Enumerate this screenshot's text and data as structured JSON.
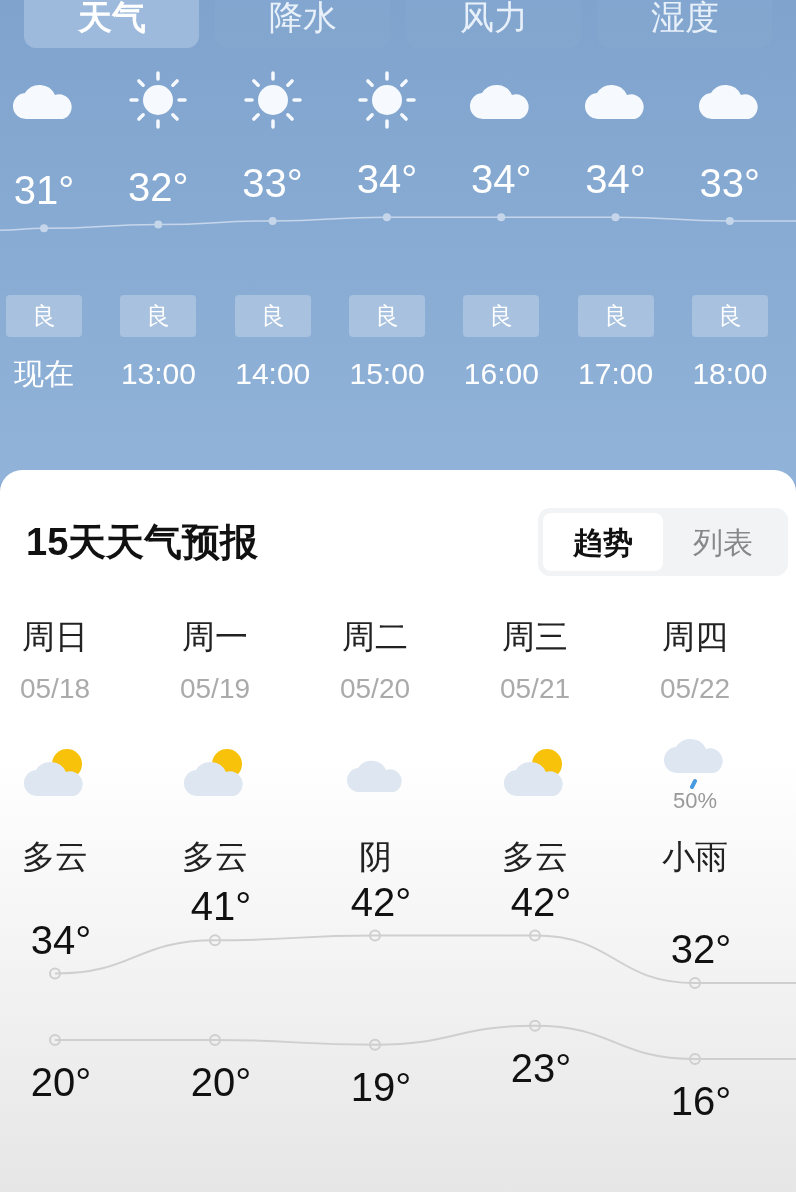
{
  "tabs": [
    {
      "label": "天气",
      "selected": true
    },
    {
      "label": "降水",
      "selected": false
    },
    {
      "label": "风力",
      "selected": false
    },
    {
      "label": "湿度",
      "selected": false
    }
  ],
  "hourly": [
    {
      "kind": "cloud",
      "aqi": "良"
    },
    {
      "kind": "sun",
      "aqi": "良"
    },
    {
      "kind": "sun",
      "aqi": "良"
    },
    {
      "kind": "sun",
      "aqi": "良"
    },
    {
      "kind": "cloud",
      "aqi": "良"
    },
    {
      "kind": "cloud",
      "aqi": "良"
    },
    {
      "kind": "cloud",
      "aqi": "良"
    }
  ],
  "hourly_chart": {
    "chart_data": {
      "type": "line",
      "categories": [
        "现在",
        "13:00",
        "14:00",
        "15:00",
        "16:00",
        "17:00",
        "18:00"
      ],
      "series": [
        {
          "color": "#c6d6ea",
          "marker": "o",
          "values": [
            31,
            32,
            33,
            34,
            34,
            34,
            33
          ],
          "value_labels": [
            "31°",
            "32°",
            "33°",
            "34°",
            "34°",
            "34°",
            "33°"
          ]
        }
      ]
    }
  },
  "forecast": {
    "title": "15天天气预报",
    "views": [
      {
        "label": "趋势",
        "selected": true
      },
      {
        "label": "列表",
        "selected": false
      }
    ],
    "days": [
      {
        "date": "05/18",
        "kind": "partly_cloudy",
        "desc": "多云"
      },
      {
        "date": "05/19",
        "kind": "partly_cloudy",
        "desc": "多云"
      },
      {
        "date": "05/20",
        "kind": "cloudy",
        "desc": "阴"
      },
      {
        "date": "05/21",
        "kind": "partly_cloudy",
        "desc": "多云"
      },
      {
        "date": "05/22",
        "kind": "rain",
        "precip": "50%",
        "desc": "小雨"
      }
    ],
    "chart_data": {
      "type": "line",
      "categories": [
        "周日",
        "周一",
        "周二",
        "周三",
        "周四"
      ],
      "series": [
        {
          "color": "#cfcfcf",
          "marker": "o",
          "values": [
            34,
            41,
            42,
            42,
            32
          ],
          "value_labels": [
            "34°",
            "41°",
            "42°",
            "42°",
            "32°"
          ]
        },
        {
          "color": "#cfcfcf",
          "marker": "o",
          "values": [
            20,
            20,
            19,
            23,
            16
          ],
          "value_labels": [
            "20°",
            "20°",
            "19°",
            "23°",
            "16°"
          ]
        }
      ]
    }
  }
}
